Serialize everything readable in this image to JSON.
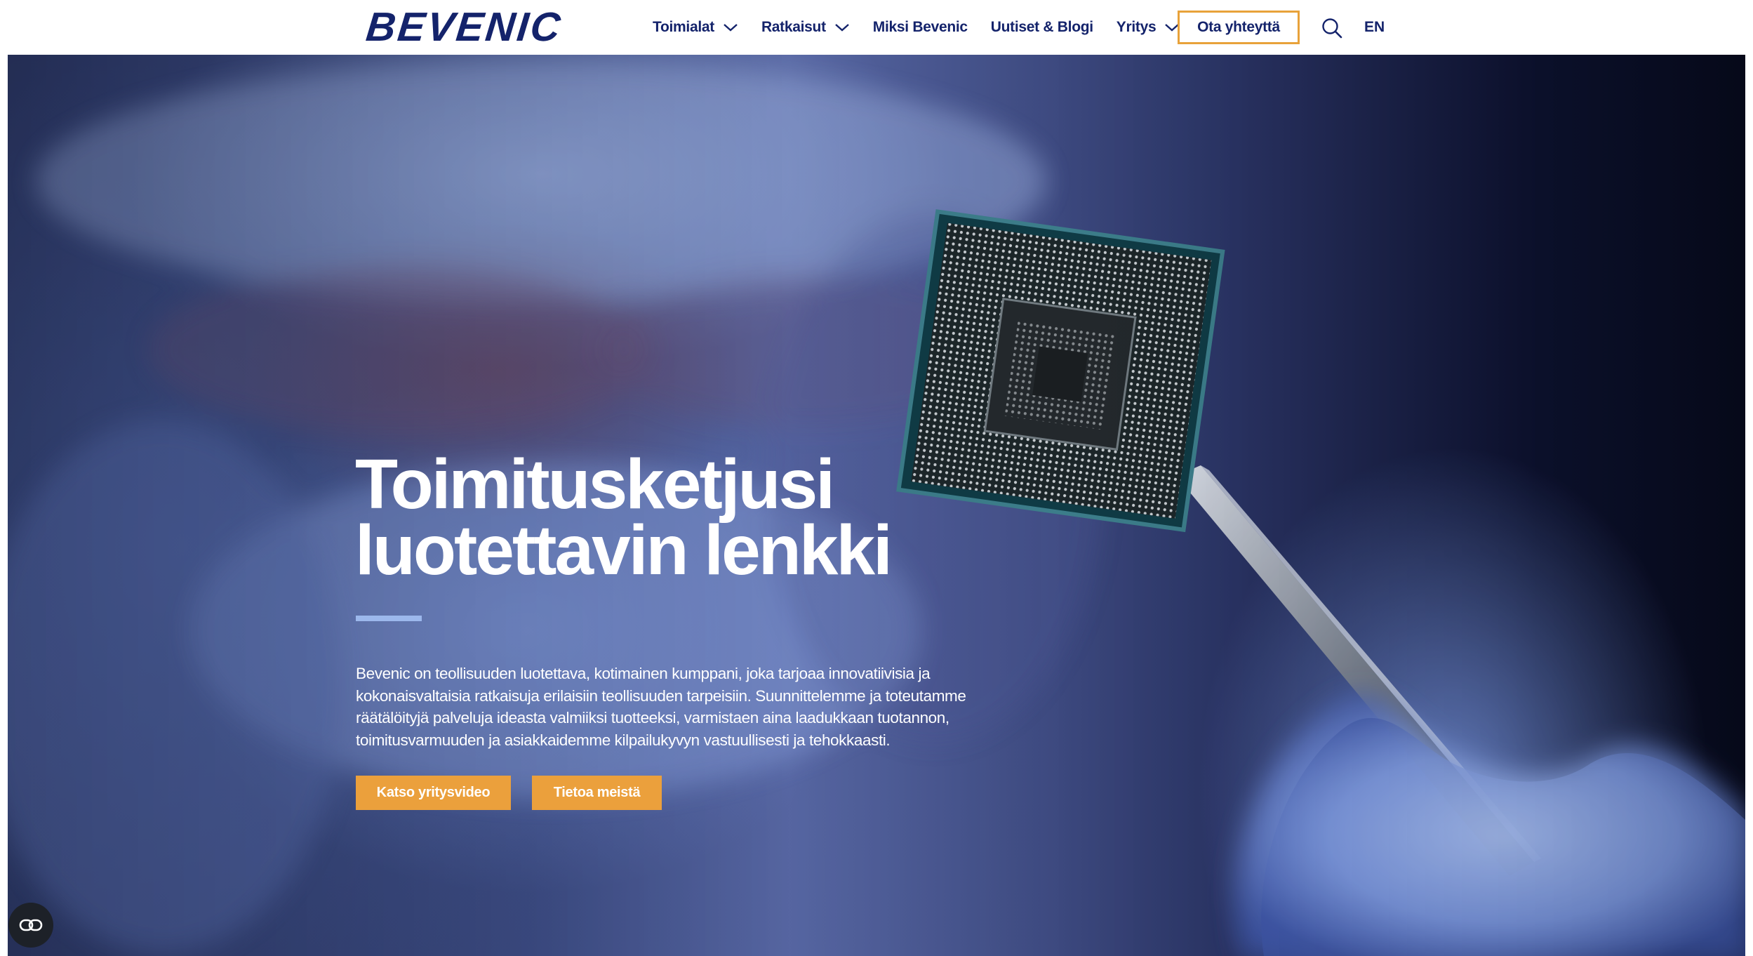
{
  "brand": {
    "logo_text": "BEVENIC",
    "color": "#14236b"
  },
  "nav": {
    "items": [
      {
        "label": "Toimialat",
        "dropdown": true
      },
      {
        "label": "Ratkaisut",
        "dropdown": true
      },
      {
        "label": "Miksi Bevenic",
        "dropdown": false
      },
      {
        "label": "Uutiset & Blogi",
        "dropdown": false
      },
      {
        "label": "Yritys",
        "dropdown": true
      }
    ],
    "cta_label": "Ota yhteyttä",
    "search_icon": "search-icon",
    "language": "EN"
  },
  "hero": {
    "title_line1": "Toimitusketjusi",
    "title_line2": "luotettavin lenkki",
    "body": "Bevenic on teollisuuden luotettava, kotimainen kumppani, joka tarjoaa innovatiivisia ja kokonaisvaltaisia ratkaisuja erilaisiin teollisuuden tarpeisiin. Suunnittelemme ja toteutamme räätälöityjä palveluja ideasta valmiiksi tuotteeksi, varmistaen aina laadukkaan tuotannon, toimitusvarmuuden ja asiakkaidemme kilpailukyvyn vastuullisesti ja tehokkaasti.",
    "buttons": {
      "video_label": "Katso yritysvideo",
      "about_label": "Tietoa meistä"
    }
  },
  "accessibility_button": {
    "icon": "accessibility-toggle-icon"
  },
  "colors": {
    "accent": "#eba03c",
    "cta_border": "#e8a23a",
    "divider": "#9cb8ec",
    "text_dark": "#14236b"
  }
}
